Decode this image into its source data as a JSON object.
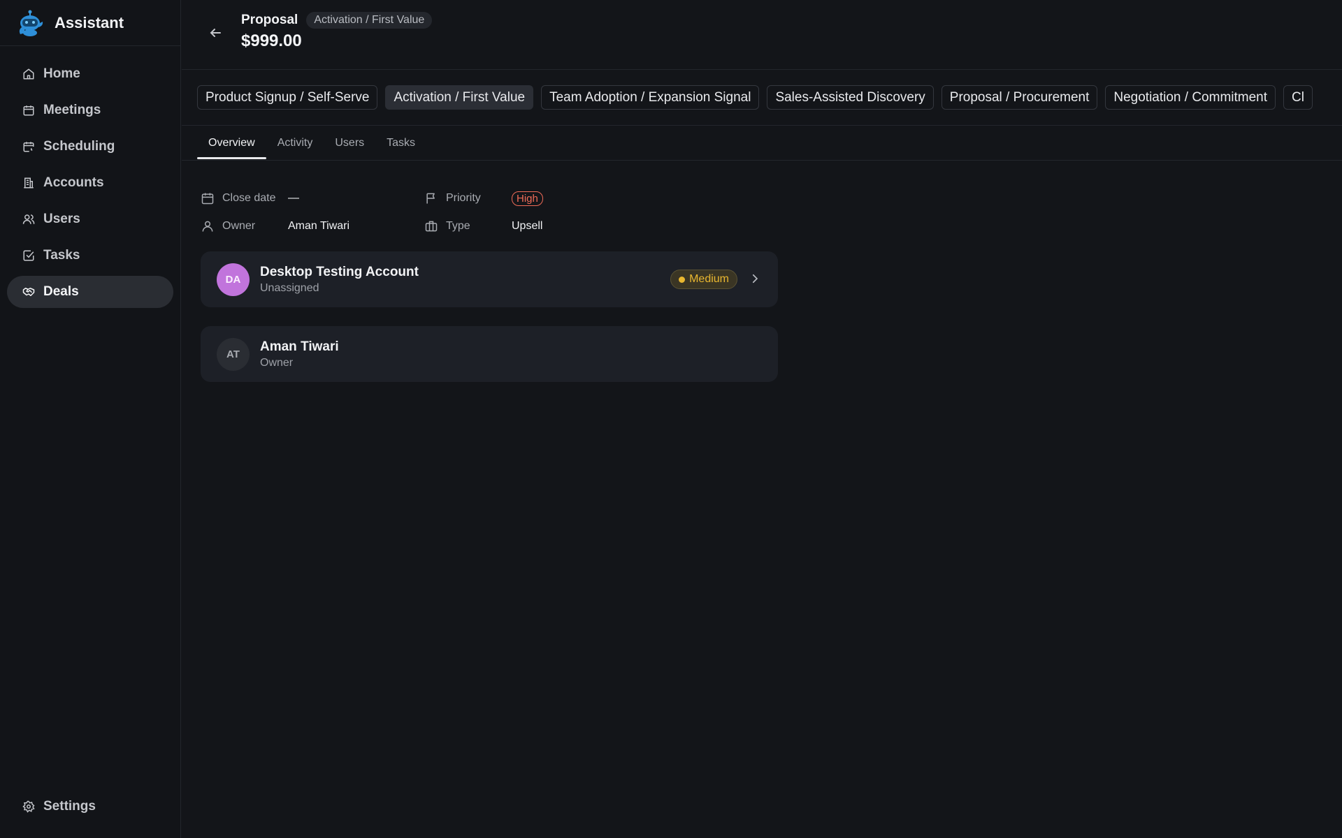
{
  "app": {
    "title": "Assistant"
  },
  "sidebar": {
    "items": [
      {
        "label": "Home",
        "icon": "home-icon"
      },
      {
        "label": "Meetings",
        "icon": "calendar-icon"
      },
      {
        "label": "Scheduling",
        "icon": "calendar-clock-icon"
      },
      {
        "label": "Accounts",
        "icon": "building-icon"
      },
      {
        "label": "Users",
        "icon": "users-icon"
      },
      {
        "label": "Tasks",
        "icon": "checkbox-icon"
      },
      {
        "label": "Deals",
        "icon": "handshake-icon",
        "active": true
      }
    ],
    "settings_label": "Settings"
  },
  "deal": {
    "title": "Proposal",
    "stage": "Activation / First Value",
    "amount": "$999.00"
  },
  "stages": [
    "Product Signup / Self-Serve",
    "Activation / First Value",
    "Team Adoption / Expansion Signal",
    "Sales-Assisted Discovery",
    "Proposal / Procurement",
    "Negotiation / Commitment",
    "Cl"
  ],
  "active_stage_index": 1,
  "tabs": [
    "Overview",
    "Activity",
    "Users",
    "Tasks"
  ],
  "active_tab": "Overview",
  "properties": {
    "close_date_label": "Close date",
    "close_date_value": "—",
    "priority_label": "Priority",
    "priority_value": "High",
    "owner_label": "Owner",
    "owner_value": "Aman Tiwari",
    "type_label": "Type",
    "type_value": "Upsell"
  },
  "account_card": {
    "initials": "DA",
    "name": "Desktop Testing Account",
    "subtitle": "Unassigned",
    "badge": "Medium"
  },
  "owner_card": {
    "initials": "AT",
    "name": "Aman Tiwari",
    "subtitle": "Owner"
  },
  "colors": {
    "accent_avatar": "#c174dc",
    "priority_high": "#ef6b57",
    "medium_badge": "#e9b730"
  }
}
